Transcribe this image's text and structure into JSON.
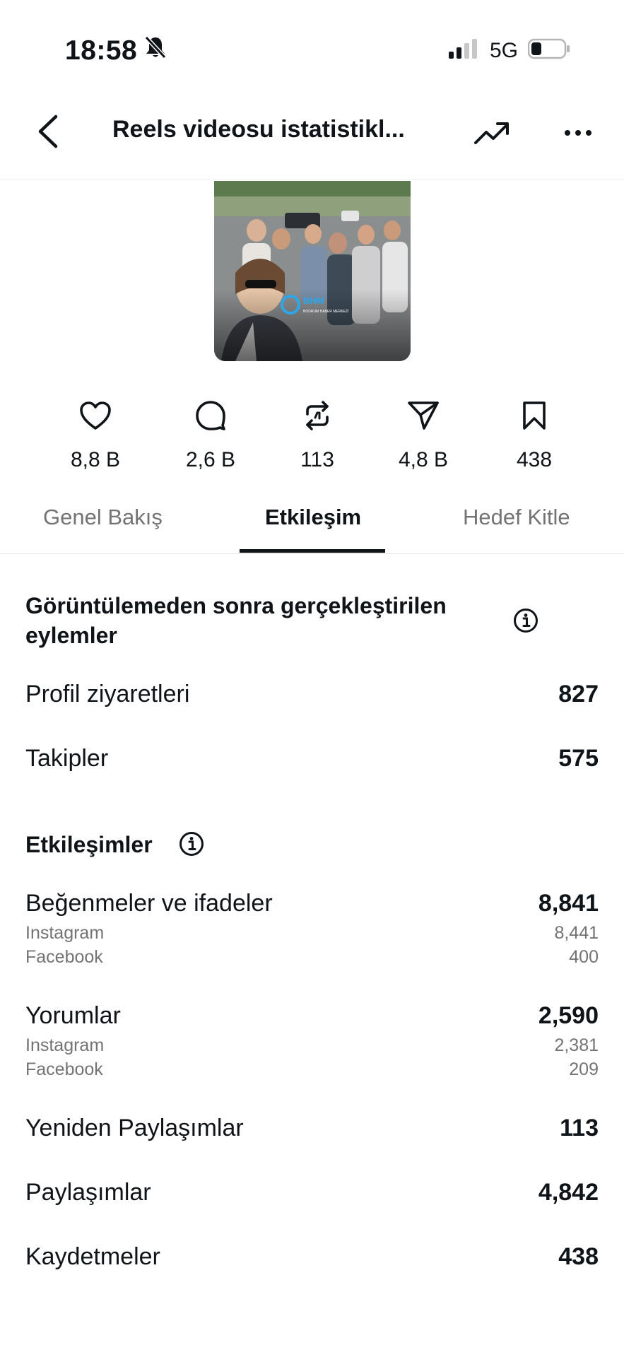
{
  "status_bar": {
    "time": "18:58",
    "network": "5G"
  },
  "header": {
    "title": "Reels videosu istatistikl..."
  },
  "stats": [
    {
      "icon": "heart-icon",
      "value": "8,8 B"
    },
    {
      "icon": "comment-icon",
      "value": "2,6 B"
    },
    {
      "icon": "repost-icon",
      "value": "113"
    },
    {
      "icon": "share-icon",
      "value": "4,8 B"
    },
    {
      "icon": "bookmark-icon",
      "value": "438"
    }
  ],
  "tabs": [
    "Genel Bakış",
    "Etkileşim",
    "Hedef Kitle"
  ],
  "actions_section": {
    "title": "Görüntülemeden sonra gerçekleştirilen eylemler",
    "title_line1": "Görüntülemeden sonra gerçekleştirilen",
    "title_line2": "eylemler",
    "rows": [
      {
        "label": "Profil ziyaretleri",
        "value": "827"
      },
      {
        "label": "Takipler",
        "value": "575"
      }
    ]
  },
  "interactions_section": {
    "title": "Etkileşimler",
    "likes": {
      "label": "Beğenmeler ve ifadeler",
      "value": "8,841",
      "instagram_label": "Instagram",
      "instagram_value": "8,441",
      "facebook_label": "Facebook",
      "facebook_value": "400"
    },
    "comments": {
      "label": "Yorumlar",
      "value": "2,590",
      "instagram_label": "Instagram",
      "instagram_value": "2,381",
      "facebook_label": "Facebook",
      "facebook_value": "209"
    },
    "reposts": {
      "label": "Yeniden Paylaşımlar",
      "value": "113"
    },
    "shares": {
      "label": "Paylaşımlar",
      "value": "4,842"
    },
    "saves": {
      "label": "Kaydetmeler",
      "value": "438"
    }
  },
  "colors": {
    "text": "#0f1419",
    "muted": "#737373",
    "divider": "#e5e5e5"
  }
}
